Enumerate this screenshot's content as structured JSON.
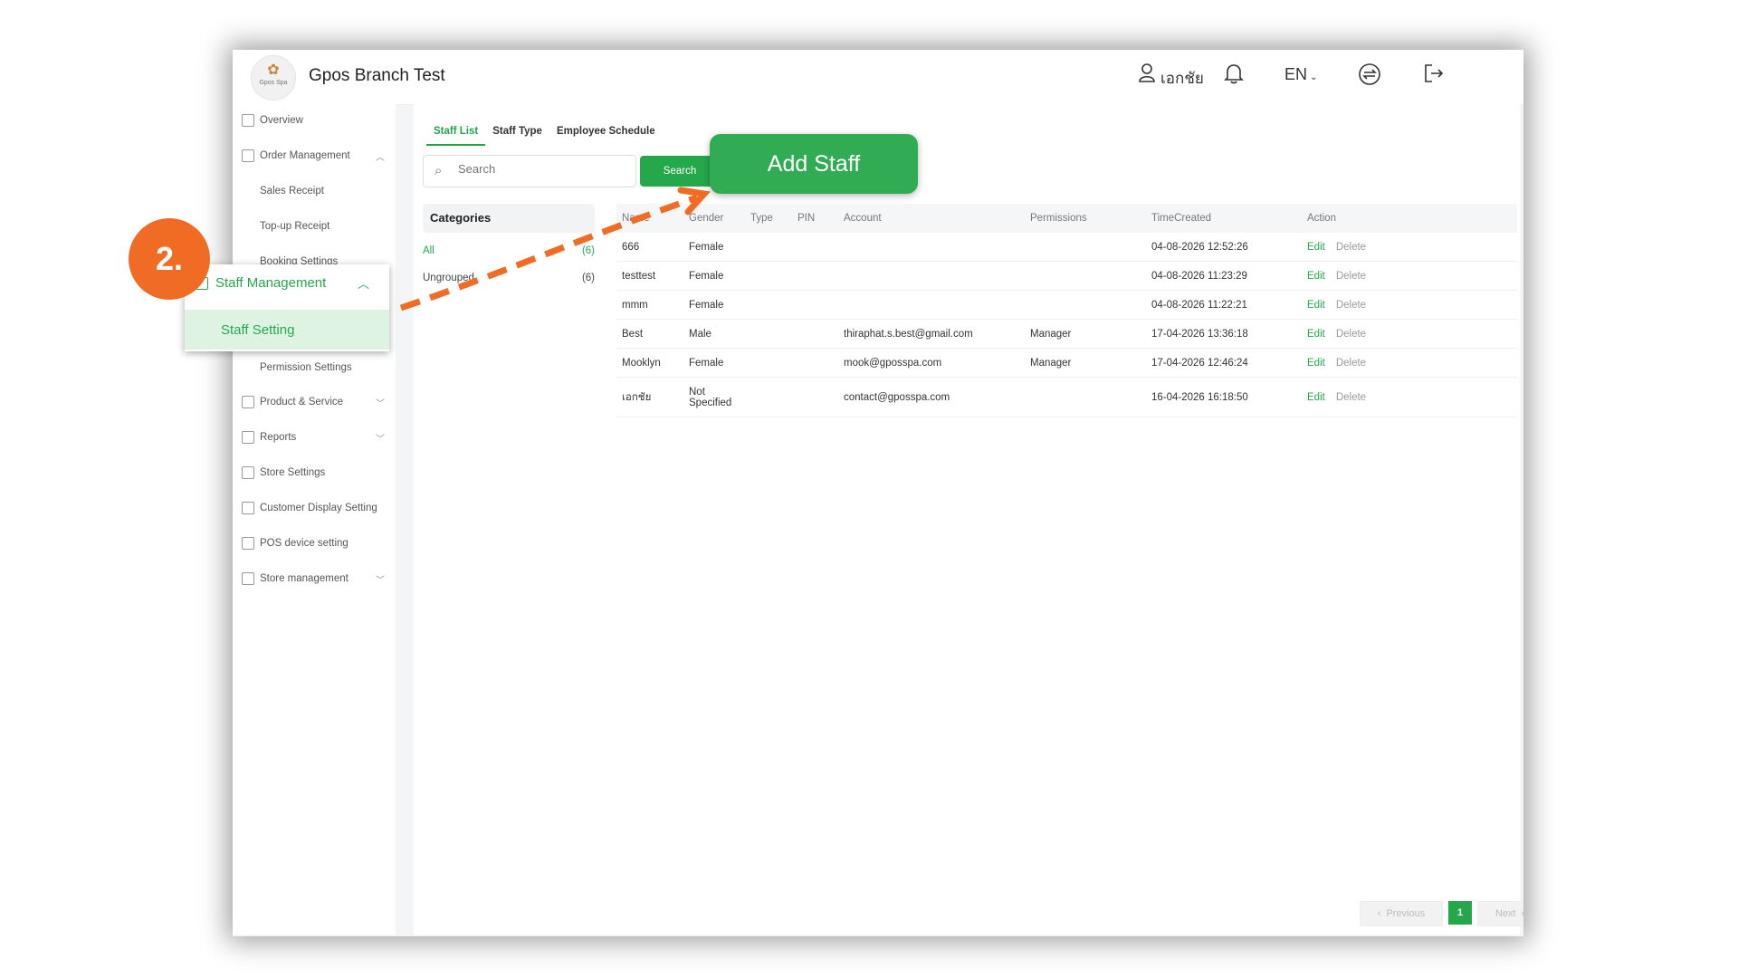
{
  "header": {
    "branch_name": "Gpos Branch Test",
    "logo_text": "Gpos Spa",
    "user_name": "เอกชัย",
    "language": "EN"
  },
  "sidebar": {
    "items": [
      {
        "label": "Overview"
      },
      {
        "label": "Order Management"
      },
      {
        "label": "Sales Receipt"
      },
      {
        "label": "Top-up Receipt"
      },
      {
        "label": "Booking Settings"
      },
      {
        "label": "Permission Settings"
      },
      {
        "label": "Product & Service"
      },
      {
        "label": "Reports"
      },
      {
        "label": "Store Settings"
      },
      {
        "label": "Customer Display Setting"
      },
      {
        "label": "POS device setting"
      },
      {
        "label": "Store management"
      }
    ],
    "popup": {
      "parent": "Staff Management",
      "child": "Staff Setting"
    }
  },
  "tabs": [
    "Staff List",
    "Staff Type",
    "Employee Schedule"
  ],
  "search": {
    "placeholder": "Search",
    "button": "Search"
  },
  "categories": {
    "title": "Categories",
    "items": [
      {
        "label": "All",
        "count": "(6)"
      },
      {
        "label": "Ungrouped",
        "count": "(6)"
      }
    ]
  },
  "table": {
    "headers": [
      "Name",
      "Gender",
      "Type",
      "PIN",
      "Account",
      "Permissions",
      "TimeCreated",
      "Action"
    ],
    "edit_label": "Edit",
    "delete_label": "Delete",
    "rows": [
      {
        "name": "666",
        "gender": "Female",
        "type": "",
        "pin": "",
        "account": "",
        "permissions": "",
        "time": "04-08-2026 12:52:26"
      },
      {
        "name": "testtest",
        "gender": "Female",
        "type": "",
        "pin": "",
        "account": "",
        "permissions": "",
        "time": "04-08-2026 11:23:29"
      },
      {
        "name": "mmm",
        "gender": "Female",
        "type": "",
        "pin": "",
        "account": "",
        "permissions": "",
        "time": "04-08-2026 11:22:21"
      },
      {
        "name": "Best",
        "gender": "Male",
        "type": "",
        "pin": "",
        "account": "thiraphat.s.best@gmail.com",
        "permissions": "Manager",
        "time": "17-04-2026 13:36:18"
      },
      {
        "name": "Mooklyn",
        "gender": "Female",
        "type": "",
        "pin": "",
        "account": "mook@gposspa.com",
        "permissions": "Manager",
        "time": "17-04-2026 12:46:24"
      },
      {
        "name": "เอกชัย",
        "gender": "Not Specified",
        "type": "",
        "pin": "",
        "account": "contact@gposspa.com",
        "permissions": "",
        "time": "16-04-2026 16:18:50"
      }
    ]
  },
  "pagination": {
    "previous": "Previous",
    "current": "1",
    "next": "Next"
  },
  "annotation": {
    "step": "2.",
    "callout": "Add Staff"
  },
  "colors": {
    "accent": "#25a84c",
    "step": "#f06c25"
  }
}
